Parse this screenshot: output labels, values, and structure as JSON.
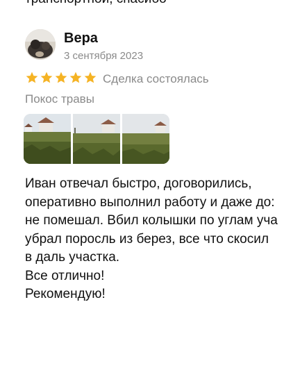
{
  "top_text": "транспортной, спасибо",
  "review": {
    "reviewer_name": "Вера",
    "date": "3 сентября 2023",
    "rating": 5,
    "rating_max": 5,
    "deal_status": "Сделка состоялась",
    "service": "Покос травы",
    "photo_count": 3,
    "text_lines": [
      "Иван отвечал быстро, договорились,",
      "оперативно выполнил работу и даже до:",
      "не помешал.  Вбил колышки по углам уча",
      "убрал поросль из берез, все что скосил",
      "в даль участка.",
      "Все отлично!",
      "Рекомендую!"
    ]
  },
  "colors": {
    "star": "#f5b324",
    "muted_text": "#8a8a8a"
  },
  "icons": {
    "star": "star-icon"
  }
}
